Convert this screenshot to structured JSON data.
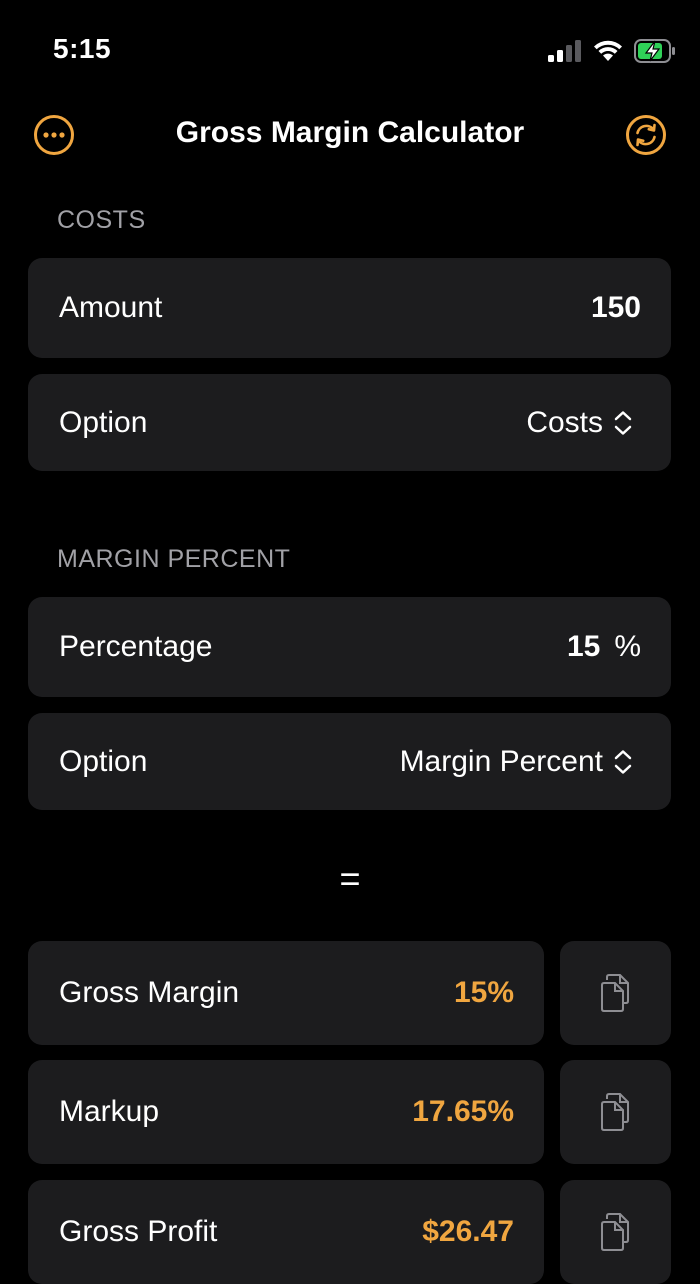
{
  "status_bar": {
    "time": "5:15"
  },
  "nav": {
    "title": "Gross Margin Calculator",
    "menu_icon": "ellipsis-circle-icon",
    "refresh_icon": "arrow-circle-icon"
  },
  "costs_section": {
    "header": "COSTS",
    "amount_label": "Amount",
    "amount_value": "150",
    "option_label": "Option",
    "option_value": "Costs"
  },
  "margin_section": {
    "header": "MARGIN PERCENT",
    "percentage_label": "Percentage",
    "percentage_value": "15",
    "percentage_unit": "%",
    "option_label": "Option",
    "option_value": "Margin Percent"
  },
  "equals_sign": "=",
  "results": [
    {
      "label": "Gross Margin",
      "value": "15%"
    },
    {
      "label": "Markup",
      "value": "17.65%"
    },
    {
      "label": "Gross Profit",
      "value": "$26.47"
    }
  ],
  "colors": {
    "accent": "#f0a640",
    "card_bg": "#1c1c1e",
    "background": "#000000",
    "secondary_text": "#a1a1a6"
  }
}
